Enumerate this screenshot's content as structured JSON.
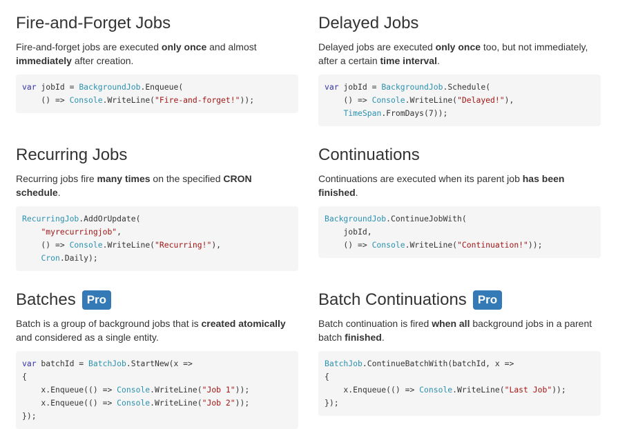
{
  "badge_label": "Pro",
  "colors": {
    "badge_bg": "#337ab7",
    "code_bg": "#f5f5f5",
    "keyword": "#3333aa",
    "type": "#2b91af",
    "string": "#a31515",
    "text": "#333333"
  },
  "sections": [
    {
      "title": "Fire-and-Forget Jobs",
      "pro": false,
      "description": [
        {
          "t": "Fire-and-forget jobs are executed "
        },
        {
          "t": "only once",
          "b": true
        },
        {
          "t": " and almost "
        },
        {
          "t": "immediately",
          "b": true
        },
        {
          "t": " after creation."
        }
      ],
      "code": [
        [
          {
            "k": "kw",
            "t": "var"
          },
          {
            "k": "pl",
            "t": " jobId = "
          },
          {
            "k": "ty",
            "t": "BackgroundJob"
          },
          {
            "k": "pl",
            "t": ".Enqueue("
          }
        ],
        [
          {
            "k": "pl",
            "t": "    () => "
          },
          {
            "k": "ty",
            "t": "Console"
          },
          {
            "k": "pl",
            "t": ".WriteLine("
          },
          {
            "k": "st",
            "t": "\"Fire-and-forget!\""
          },
          {
            "k": "pl",
            "t": "));"
          }
        ]
      ]
    },
    {
      "title": "Delayed Jobs",
      "pro": false,
      "description": [
        {
          "t": "Delayed jobs are executed "
        },
        {
          "t": "only once",
          "b": true
        },
        {
          "t": " too, but not immediately, after a certain "
        },
        {
          "t": "time interval",
          "b": true
        },
        {
          "t": "."
        }
      ],
      "code": [
        [
          {
            "k": "kw",
            "t": "var"
          },
          {
            "k": "pl",
            "t": " jobId = "
          },
          {
            "k": "ty",
            "t": "BackgroundJob"
          },
          {
            "k": "pl",
            "t": ".Schedule("
          }
        ],
        [
          {
            "k": "pl",
            "t": "    () => "
          },
          {
            "k": "ty",
            "t": "Console"
          },
          {
            "k": "pl",
            "t": ".WriteLine("
          },
          {
            "k": "st",
            "t": "\"Delayed!\""
          },
          {
            "k": "pl",
            "t": "),"
          }
        ],
        [
          {
            "k": "pl",
            "t": "    "
          },
          {
            "k": "ty",
            "t": "TimeSpan"
          },
          {
            "k": "pl",
            "t": ".FromDays(7));"
          }
        ]
      ]
    },
    {
      "title": "Recurring Jobs",
      "pro": false,
      "description": [
        {
          "t": "Recurring jobs fire "
        },
        {
          "t": "many times",
          "b": true
        },
        {
          "t": " on the specified "
        },
        {
          "t": "CRON schedule",
          "b": true
        },
        {
          "t": "."
        }
      ],
      "code": [
        [
          {
            "k": "ty",
            "t": "RecurringJob"
          },
          {
            "k": "pl",
            "t": ".AddOrUpdate("
          }
        ],
        [
          {
            "k": "pl",
            "t": "    "
          },
          {
            "k": "st",
            "t": "\"myrecurringjob\""
          },
          {
            "k": "pl",
            "t": ","
          }
        ],
        [
          {
            "k": "pl",
            "t": "    () => "
          },
          {
            "k": "ty",
            "t": "Console"
          },
          {
            "k": "pl",
            "t": ".WriteLine("
          },
          {
            "k": "st",
            "t": "\"Recurring!\""
          },
          {
            "k": "pl",
            "t": "),"
          }
        ],
        [
          {
            "k": "pl",
            "t": "    "
          },
          {
            "k": "ty",
            "t": "Cron"
          },
          {
            "k": "pl",
            "t": ".Daily);"
          }
        ]
      ]
    },
    {
      "title": "Continuations",
      "pro": false,
      "description": [
        {
          "t": "Continuations are executed when its parent job "
        },
        {
          "t": "has been finished",
          "b": true
        },
        {
          "t": "."
        }
      ],
      "code": [
        [
          {
            "k": "ty",
            "t": "BackgroundJob"
          },
          {
            "k": "pl",
            "t": ".ContinueJobWith("
          }
        ],
        [
          {
            "k": "pl",
            "t": "    jobId,"
          }
        ],
        [
          {
            "k": "pl",
            "t": "    () => "
          },
          {
            "k": "ty",
            "t": "Console"
          },
          {
            "k": "pl",
            "t": ".WriteLine("
          },
          {
            "k": "st",
            "t": "\"Continuation!\""
          },
          {
            "k": "pl",
            "t": "));"
          }
        ]
      ]
    },
    {
      "title": "Batches",
      "pro": true,
      "description": [
        {
          "t": "Batch is a group of background jobs that is "
        },
        {
          "t": "created atomically",
          "b": true
        },
        {
          "t": " and considered as a single entity."
        }
      ],
      "code": [
        [
          {
            "k": "kw",
            "t": "var"
          },
          {
            "k": "pl",
            "t": " batchId = "
          },
          {
            "k": "ty",
            "t": "BatchJob"
          },
          {
            "k": "pl",
            "t": ".StartNew(x =>"
          }
        ],
        [
          {
            "k": "pl",
            "t": "{"
          }
        ],
        [
          {
            "k": "pl",
            "t": "    x.Enqueue(() => "
          },
          {
            "k": "ty",
            "t": "Console"
          },
          {
            "k": "pl",
            "t": ".WriteLine("
          },
          {
            "k": "st",
            "t": "\"Job 1\""
          },
          {
            "k": "pl",
            "t": "));"
          }
        ],
        [
          {
            "k": "pl",
            "t": "    x.Enqueue(() => "
          },
          {
            "k": "ty",
            "t": "Console"
          },
          {
            "k": "pl",
            "t": ".WriteLine("
          },
          {
            "k": "st",
            "t": "\"Job 2\""
          },
          {
            "k": "pl",
            "t": "));"
          }
        ],
        [
          {
            "k": "pl",
            "t": "});"
          }
        ]
      ]
    },
    {
      "title": "Batch Continuations",
      "pro": true,
      "description": [
        {
          "t": "Batch continuation is fired "
        },
        {
          "t": "when all",
          "b": true
        },
        {
          "t": " background jobs in a parent batch "
        },
        {
          "t": "finished",
          "b": true
        },
        {
          "t": "."
        }
      ],
      "code": [
        [
          {
            "k": "ty",
            "t": "BatchJob"
          },
          {
            "k": "pl",
            "t": ".ContinueBatchWith(batchId, x =>"
          }
        ],
        [
          {
            "k": "pl",
            "t": "{"
          }
        ],
        [
          {
            "k": "pl",
            "t": "    x.Enqueue(() => "
          },
          {
            "k": "ty",
            "t": "Console"
          },
          {
            "k": "pl",
            "t": ".WriteLine("
          },
          {
            "k": "st",
            "t": "\"Last Job\""
          },
          {
            "k": "pl",
            "t": "));"
          }
        ],
        [
          {
            "k": "pl",
            "t": "});"
          }
        ]
      ]
    }
  ]
}
